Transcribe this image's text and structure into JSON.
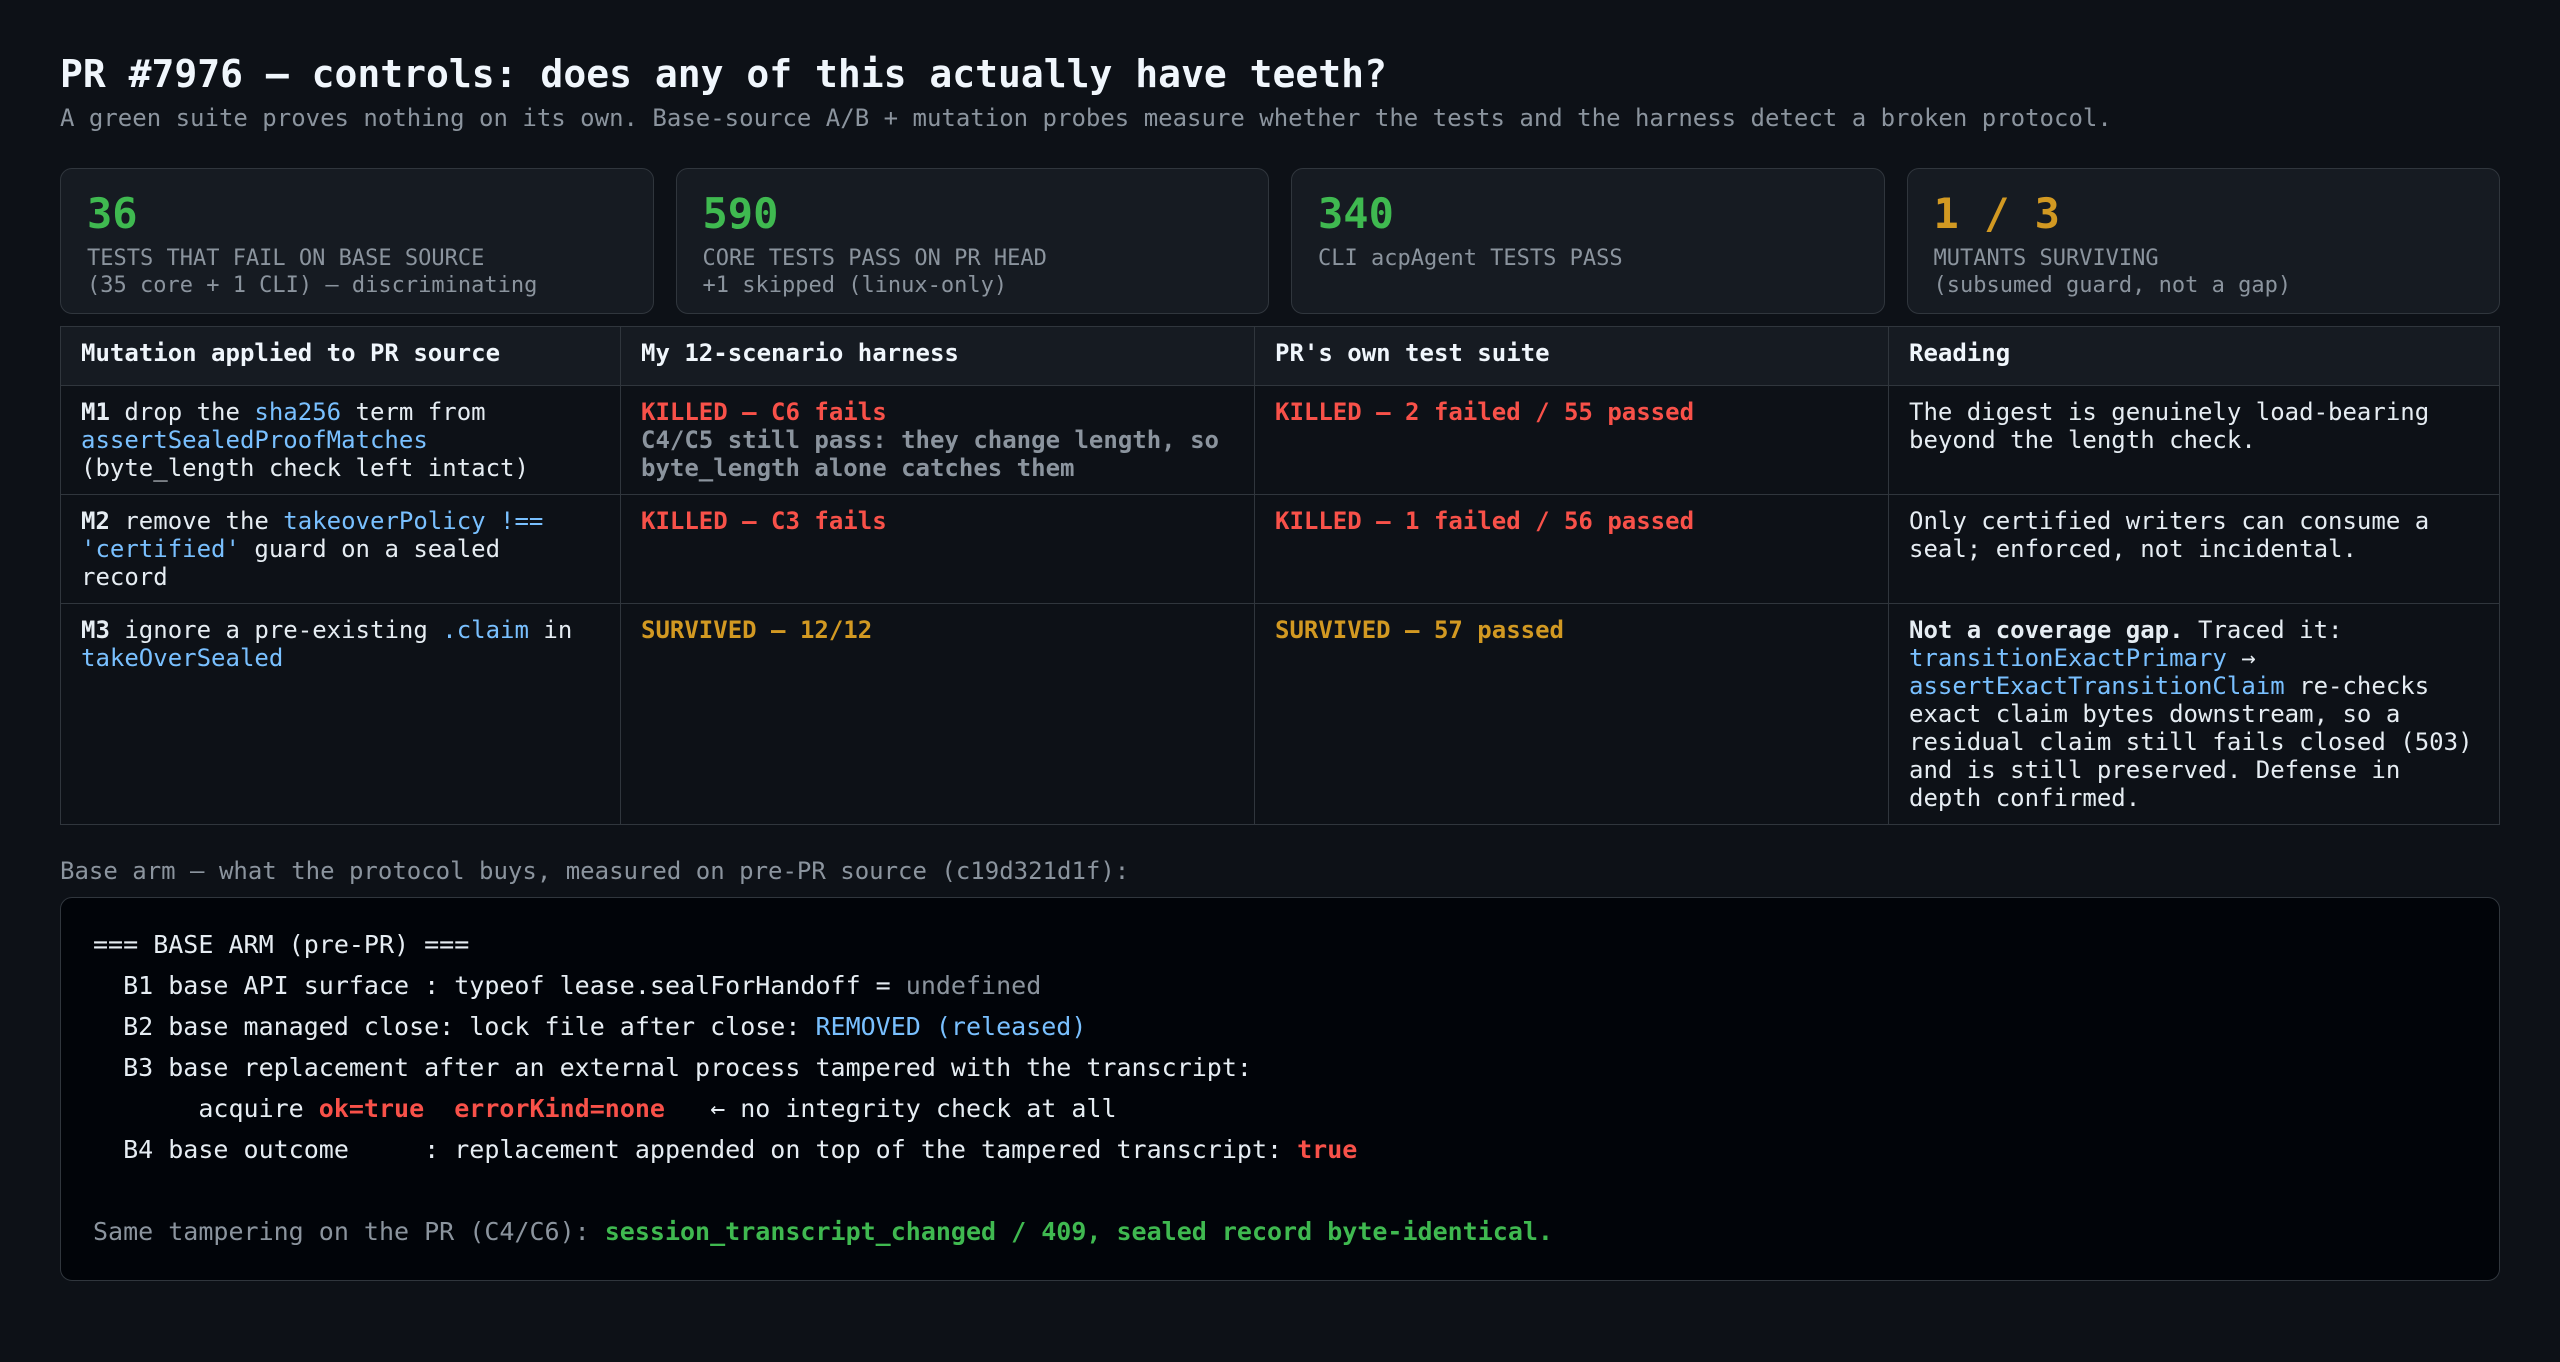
{
  "header": {
    "title": "PR #7976 — controls: does any of this actually have teeth?",
    "subtitle": "A green suite proves nothing on its own. Base-source A/B + mutation probes measure whether the tests and the harness detect a broken protocol."
  },
  "stats": [
    {
      "value": "36",
      "line1": "TESTS THAT FAIL ON BASE SOURCE",
      "line2": "(35 core + 1 CLI) — discriminating",
      "color": "green"
    },
    {
      "value": "590",
      "line1": "CORE TESTS PASS ON PR HEAD",
      "line2": "+1 skipped (linux-only)",
      "color": "green"
    },
    {
      "value": "340",
      "line1": "CLI acpAgent TESTS PASS",
      "line2": "",
      "color": "green"
    },
    {
      "value": "1 / 3",
      "line1": "MUTANTS SURVIVING",
      "line2": "(subsumed guard, not a gap)",
      "color": "amber"
    }
  ],
  "table": {
    "headers": [
      "Mutation applied to PR source",
      "My 12-scenario harness",
      "PR's own test suite",
      "Reading"
    ],
    "rows": [
      {
        "id": "M1",
        "mut_a": " drop the ",
        "mut_code1": "sha256",
        "mut_b": " term from ",
        "mut_code2": "assertSealedProofMatches",
        "mut_c": "(byte_length check left intact)",
        "harness": "KILLED — C6 fails",
        "harness_note": "C4/C5 still pass: they change length, so byte_length alone catches them",
        "suite": "KILLED — 2 failed / 55 passed",
        "reading": "The digest is genuinely load-bearing beyond the length check."
      },
      {
        "id": "M2",
        "mut_a": " remove the ",
        "mut_code1": "takeoverPolicy !== 'certified'",
        "mut_b": " guard on a sealed record",
        "harness": "KILLED — C3 fails",
        "suite": "KILLED — 1 failed / 56 passed",
        "reading": "Only certified writers can consume a seal; enforced, not incidental."
      },
      {
        "id": "M3",
        "mut_a": " ignore a pre-existing ",
        "mut_code1": ".claim",
        "mut_b": " in ",
        "mut_code2": "takeOverSealed",
        "harness": "SURVIVED — 12/12",
        "suite": "SURVIVED — 57 passed",
        "reading_bold": "Not a coverage gap.",
        "reading_a": " Traced it: ",
        "reading_code1": "transitionExactPrimary",
        "reading_arrow": " → ",
        "reading_code2": "assertExactTransitionClaim",
        "reading_b": " re-checks exact claim bytes downstream, so a residual claim still fails closed (503) and is still preserved. Defense in depth confirmed."
      }
    ]
  },
  "base_arm": {
    "label": "Base arm — what the protocol buys, measured on pre-PR source (c19d321d1f):",
    "l1": "=== BASE ARM (pre-PR) ===",
    "l2a": "  B1 base API surface : typeof lease.sealForHandoff = ",
    "l2b": "undefined",
    "l3a": "  B2 base managed close: lock file after close: ",
    "l3b": "REMOVED (released)",
    "l4": "  B3 base replacement after an external process tampered with the transcript:",
    "l5a": "       acquire ",
    "l5b": "ok=true",
    "l5c": "  ",
    "l5d": "errorKind=none",
    "l5e": "   ← no integrity check at all",
    "l6a": "  B4 base outcome     : replacement appended on top of the tampered transcript: ",
    "l6b": "true",
    "l8a": "Same tampering on the PR (C4/C6): ",
    "l8b": "session_transcript_changed / 409, sealed record byte-identical."
  },
  "colors": {
    "green": "#3fb950",
    "amber": "#d29922",
    "red": "#f85149",
    "blue": "#79c0ff"
  }
}
